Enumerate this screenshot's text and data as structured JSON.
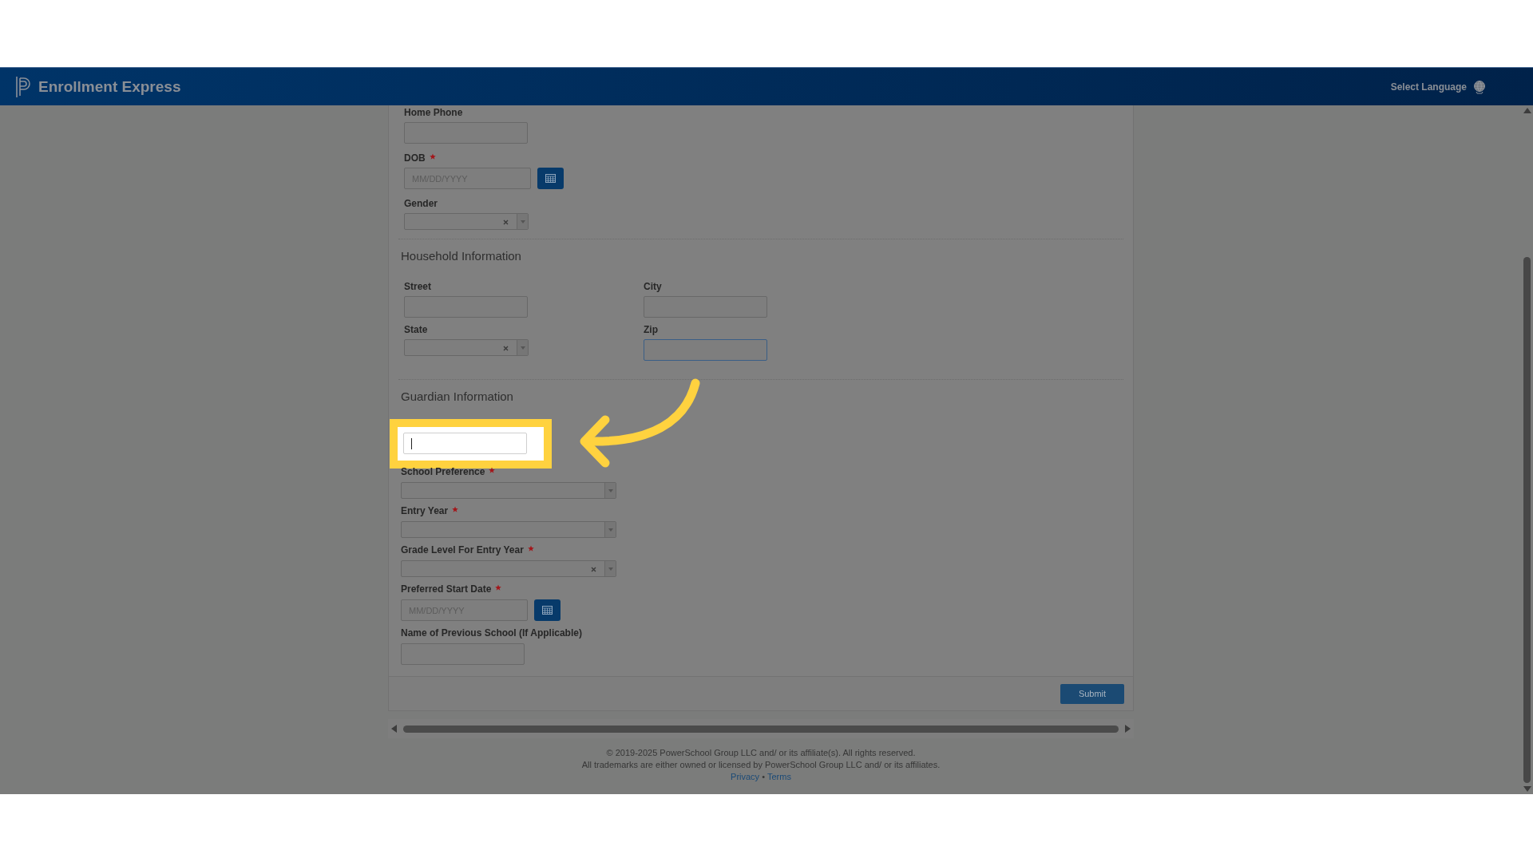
{
  "header": {
    "title": "Enrollment Express",
    "language_label": "Select Language"
  },
  "student": {
    "fields": [
      {
        "label": "Home Phone",
        "required": false,
        "kind": "text"
      },
      {
        "label": "DOB",
        "required": true,
        "kind": "date",
        "placeholder": "MM/DD/YYYY"
      },
      {
        "label": "Gender",
        "required": false,
        "kind": "select",
        "clearable": true
      }
    ]
  },
  "household": {
    "heading": "Household Information",
    "fields": [
      {
        "label": "Street",
        "required": false,
        "kind": "text",
        "focused": false
      },
      {
        "label": "City",
        "required": false,
        "kind": "text",
        "focused": false
      },
      {
        "label": "State",
        "required": false,
        "kind": "select",
        "clearable": true
      },
      {
        "label": "Zip",
        "required": false,
        "kind": "text",
        "focused": true
      }
    ]
  },
  "guardian": {
    "heading": "Guardian Information",
    "highlighted_field": {
      "kind": "text",
      "focused": true
    },
    "fields": [
      {
        "label": "School Preference",
        "required": true,
        "kind": "select",
        "clearable": false
      },
      {
        "label": "Entry Year",
        "required": true,
        "kind": "select",
        "clearable": false
      },
      {
        "label": "Grade Level For Entry Year",
        "required": true,
        "kind": "select",
        "clearable": true
      },
      {
        "label": "Preferred Start Date",
        "required": true,
        "kind": "date",
        "placeholder": "MM/DD/YYYY"
      },
      {
        "label": "Name of Previous School (If Applicable)",
        "required": false,
        "kind": "text"
      }
    ]
  },
  "submit_button": "Submit",
  "footer": {
    "lines": [
      "© 2019-2025 PowerSchool Group LLC and/ or its affiliate(s). All rights reserved.",
      "All trademarks are either owned or licensed by PowerSchool Group LLC and/ or its affiliates."
    ],
    "links": [
      "Privacy",
      "Terms"
    ],
    "separator": "•"
  }
}
